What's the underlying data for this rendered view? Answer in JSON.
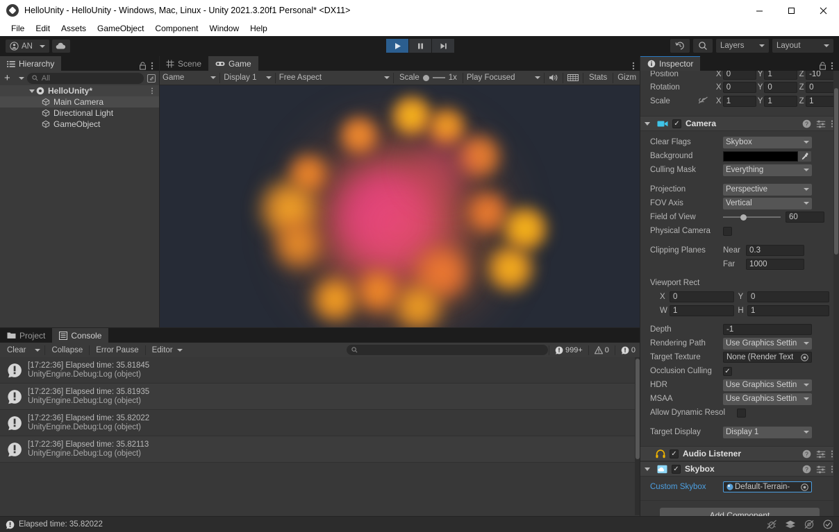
{
  "window": {
    "title": "HelloUnity - HelloUnity - Windows, Mac, Linux - Unity 2021.3.20f1 Personal* <DX11>",
    "app_icon": "unity-logo-icon",
    "minimize": "minimize-icon",
    "maximize": "maximize-icon",
    "close": "close-icon"
  },
  "menu": {
    "items": [
      "File",
      "Edit",
      "Assets",
      "GameObject",
      "Component",
      "Window",
      "Help"
    ]
  },
  "toolbar": {
    "account_label": "AN",
    "cloud_icon": "cloud-icon",
    "play_icon": "play-icon",
    "pause_icon": "pause-icon",
    "step_icon": "step-icon",
    "history_icon": "undo-history-icon",
    "search_icon": "search-icon",
    "layers_label": "Layers",
    "layout_label": "Layout"
  },
  "hierarchy": {
    "tab_label": "Hierarchy",
    "tab_icon": "hierarchy-icon",
    "lock_icon": "lock-icon",
    "menu_icon": "kebab-menu-icon",
    "add_label": "+",
    "search_placeholder": "All",
    "search_icon": "search-icon",
    "expand_icon": "expand-window-icon",
    "items": [
      {
        "label": "HelloUnity*",
        "icon": "unity-scene-icon",
        "depth": 0,
        "selected": false,
        "root": true
      },
      {
        "label": "Main Camera",
        "icon": "gameobject-cube-icon",
        "depth": 1,
        "selected": true,
        "root": false
      },
      {
        "label": "Directional Light",
        "icon": "gameobject-cube-icon",
        "depth": 1,
        "selected": false,
        "root": false
      },
      {
        "label": "GameObject",
        "icon": "gameobject-cube-icon",
        "depth": 1,
        "selected": false,
        "root": false
      }
    ]
  },
  "gameview": {
    "tabs": [
      {
        "label": "Scene",
        "icon": "scene-grid-icon",
        "active": false
      },
      {
        "label": "Game",
        "icon": "game-controller-icon",
        "active": true
      }
    ],
    "menu_icon": "kebab-menu-icon",
    "controls": {
      "view_mode": "Game",
      "display": "Display 1",
      "aspect": "Free Aspect",
      "scale_label": "Scale",
      "scale_value": "1x",
      "play_mode": "Play Focused",
      "mute_icon": "audio-mute-icon",
      "stats_toggle_icon": "frame-debug-icon",
      "stats_label": "Stats",
      "gizmos_label": "Gizm"
    },
    "background_color": "#262b36"
  },
  "console": {
    "tabs": [
      {
        "label": "Project",
        "icon": "folder-icon",
        "active": false
      },
      {
        "label": "Console",
        "icon": "console-icon",
        "active": true
      }
    ],
    "toolbar": {
      "clear_label": "Clear",
      "collapse_label": "Collapse",
      "error_pause_label": "Error Pause",
      "editor_label": "Editor",
      "search_icon": "search-icon",
      "search_value": ""
    },
    "counters": {
      "log_icon": "log-info-icon",
      "log_count": "999+",
      "warning_icon": "warning-triangle-icon",
      "warning_count": "0",
      "error_icon": "error-circle-icon",
      "error_count": "0"
    },
    "entries": [
      {
        "icon": "log-info-icon",
        "message": "[17:22:36] Elapsed time: 35.81845",
        "stack": "UnityEngine.Debug:Log (object)"
      },
      {
        "icon": "log-info-icon",
        "message": "[17:22:36] Elapsed time: 35.81935",
        "stack": "UnityEngine.Debug:Log (object)"
      },
      {
        "icon": "log-info-icon",
        "message": "[17:22:36] Elapsed time: 35.82022",
        "stack": "UnityEngine.Debug:Log (object)"
      },
      {
        "icon": "log-info-icon",
        "message": "[17:22:36] Elapsed time: 35.82113",
        "stack": "UnityEngine.Debug:Log (object)"
      }
    ]
  },
  "inspector": {
    "tab_label": "Inspector",
    "tab_icon": "info-icon",
    "lock_icon": "lock-icon",
    "menu_icon": "kebab-menu-icon",
    "transform": {
      "rows": [
        {
          "label": "Position",
          "x": "0",
          "y": "1",
          "z": "-10"
        },
        {
          "label": "Rotation",
          "x": "0",
          "y": "0",
          "z": "0"
        },
        {
          "label": "Scale",
          "x": "1",
          "y": "1",
          "z": "1",
          "link_icon": "constrain-proportions-off-icon"
        }
      ],
      "axis_x": "X",
      "axis_y": "Y",
      "axis_z": "Z"
    },
    "camera": {
      "name": "Camera",
      "icon": "camera-icon",
      "enabled": true,
      "help_icon": "help-icon",
      "preset_icon": "preset-icon",
      "menu_icon": "kebab-menu-icon",
      "clear_flags_label": "Clear Flags",
      "clear_flags_value": "Skybox",
      "background_label": "Background",
      "background_color": "#000000",
      "eyedropper_icon": "eyedropper-icon",
      "culling_mask_label": "Culling Mask",
      "culling_mask_value": "Everything",
      "projection_label": "Projection",
      "projection_value": "Perspective",
      "fov_axis_label": "FOV Axis",
      "fov_axis_value": "Vertical",
      "field_of_view_label": "Field of View",
      "field_of_view_value": "60",
      "physical_camera_label": "Physical Camera",
      "physical_camera_checked": false,
      "clipping_planes_label": "Clipping Planes",
      "near_label": "Near",
      "near_value": "0.3",
      "far_label": "Far",
      "far_value": "1000",
      "viewport_rect_label": "Viewport Rect",
      "viewport_x_label": "X",
      "viewport_x": "0",
      "viewport_y_label": "Y",
      "viewport_y": "0",
      "viewport_w_label": "W",
      "viewport_w": "1",
      "viewport_h_label": "H",
      "viewport_h": "1",
      "depth_label": "Depth",
      "depth_value": "-1",
      "rendering_path_label": "Rendering Path",
      "rendering_path_value": "Use Graphics Settin",
      "target_texture_label": "Target Texture",
      "target_texture_value": "None (Render Text",
      "object_picker_icon": "object-picker-icon",
      "occlusion_culling_label": "Occlusion Culling",
      "occlusion_culling_checked": true,
      "hdr_label": "HDR",
      "hdr_value": "Use Graphics Settin",
      "msaa_label": "MSAA",
      "msaa_value": "Use Graphics Settin",
      "allow_dynamic_label": "Allow Dynamic Resol",
      "allow_dynamic_checked": false,
      "target_display_label": "Target Display",
      "target_display_value": "Display 1"
    },
    "audio_listener": {
      "name": "Audio Listener",
      "icon": "headphones-icon",
      "enabled": true,
      "help_icon": "help-icon",
      "preset_icon": "preset-icon",
      "menu_icon": "kebab-menu-icon"
    },
    "skybox": {
      "name": "Skybox",
      "icon": "skybox-icon",
      "enabled": true,
      "help_icon": "help-icon",
      "preset_icon": "preset-icon",
      "menu_icon": "kebab-menu-icon",
      "custom_skybox_label": "Custom Skybox",
      "custom_skybox_value": "Default-Terrain-",
      "object_picker_icon": "object-picker-icon"
    },
    "add_component_label": "Add Component"
  },
  "statusbar": {
    "icon": "log-info-icon",
    "message": "Elapsed time: 35.82022",
    "icons": [
      "bug-disabled-icon",
      "layers-icon",
      "preview-disabled-icon",
      "check-circle-icon"
    ]
  }
}
